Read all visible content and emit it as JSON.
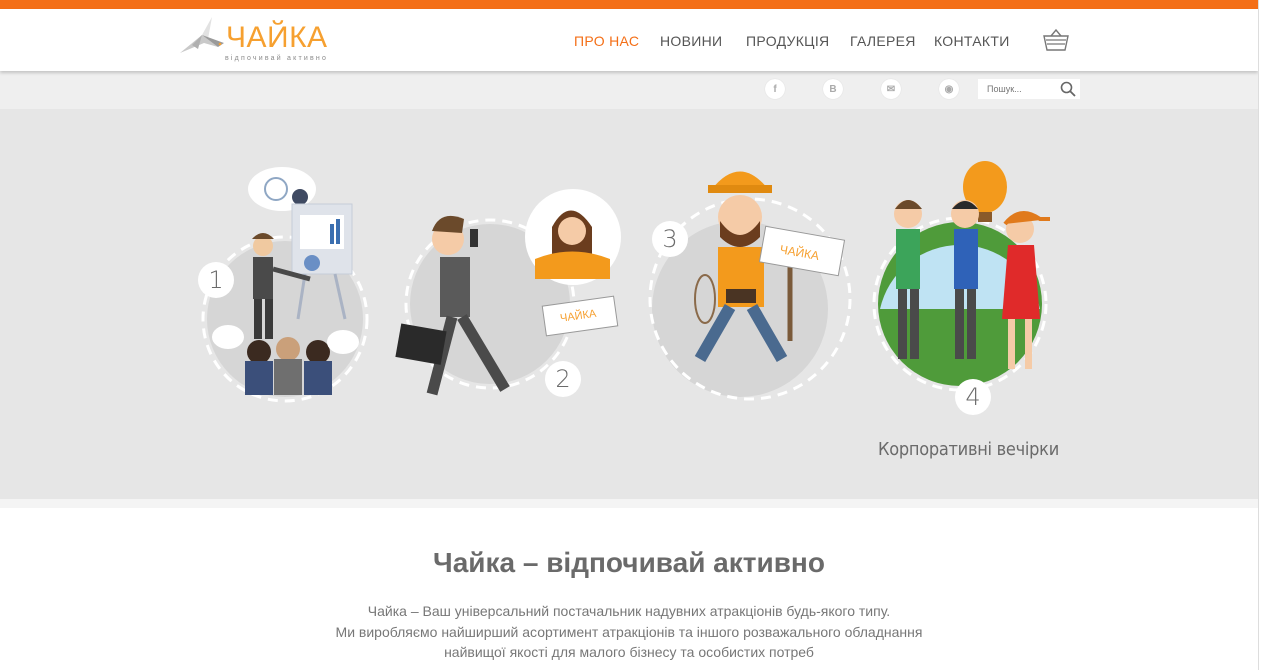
{
  "brand": {
    "name": "ЧАЙКА",
    "tagline": "відпочивай активно"
  },
  "nav": [
    {
      "label": "ПРО НАС",
      "active": true
    },
    {
      "label": "НОВИНИ",
      "active": false
    },
    {
      "label": "ПРОДУКЦІЯ",
      "active": false
    },
    {
      "label": "ГАЛЕРЕЯ",
      "active": false
    },
    {
      "label": "КОНТАКТИ",
      "active": false
    }
  ],
  "social": [
    {
      "icon": "facebook-icon",
      "glyph": "f"
    },
    {
      "icon": "vk-icon",
      "glyph": "В"
    },
    {
      "icon": "mail-icon",
      "glyph": "✉"
    },
    {
      "icon": "rss-icon",
      "glyph": "◉"
    }
  ],
  "search": {
    "placeholder": "Пошук..."
  },
  "hero": {
    "steps": [
      {
        "num": "1"
      },
      {
        "num": "2"
      },
      {
        "num": "3"
      },
      {
        "num": "4"
      }
    ],
    "caption": "Корпоративні вечірки",
    "sign_text": "ЧАЙКА"
  },
  "intro": {
    "title": "Чайка – відпочивай активно",
    "lines": [
      "Чайка – Ваш універсальний постачальник надувних атракціонів будь-якого типу.",
      "Ми виробляємо найширший асортимент атракціонів та іншого розважального обладнання",
      "найвищої якості для малого бізнесу та особистих потреб"
    ]
  },
  "colors": {
    "accent": "#f46f17",
    "logo": "#f6a030",
    "hero_bg": "#e6e6e6"
  }
}
